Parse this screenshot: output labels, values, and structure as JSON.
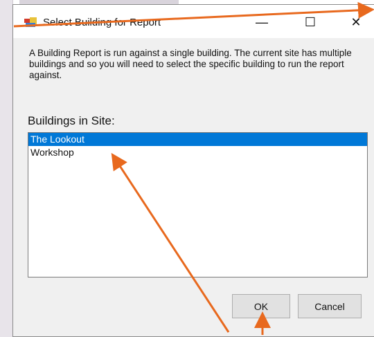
{
  "dialog": {
    "title": "Select Building for Report",
    "description": "A Building Report is run against a single building. The current site has multiple buildings and so you will need to select the specific building to run the report against.",
    "list_label": "Buildings in Site:",
    "buildings": [
      "The Lookout",
      "Workshop"
    ],
    "selected_index": 0,
    "ok_label": "OK",
    "cancel_label": "Cancel",
    "controls": {
      "minimize": "—",
      "maximize": "☐",
      "close": "✕"
    }
  },
  "colors": {
    "selection": "#0078d7",
    "annotation_arrow": "#e8691e"
  }
}
